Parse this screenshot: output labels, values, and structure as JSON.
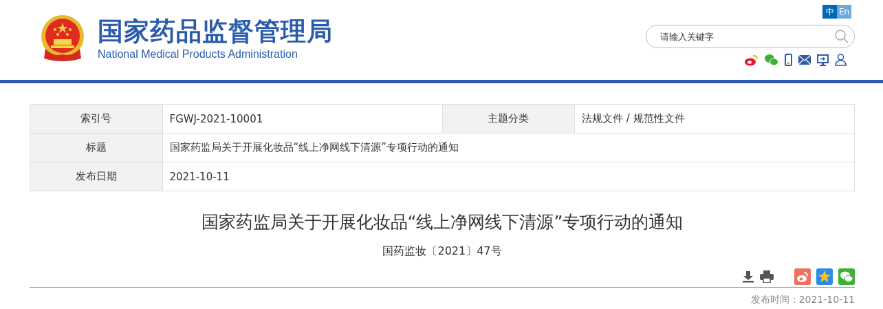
{
  "header": {
    "title_cn": "国家药品监督管理局",
    "title_en": "National Medical Products Administration",
    "languages": [
      {
        "label": "中",
        "selected": true
      },
      {
        "label": "En",
        "selected": false
      }
    ],
    "search": {
      "placeholder": "请输入关键字"
    }
  },
  "info_table": {
    "rows": [
      [
        {
          "kind": "label",
          "text": "索引号"
        },
        {
          "kind": "value",
          "text": "FGWJ-2021-10001"
        },
        {
          "kind": "label",
          "text": "主题分类"
        },
        {
          "kind": "value",
          "text": "法规文件 / 规范性文件"
        }
      ],
      [
        {
          "kind": "label",
          "text": "标题"
        },
        {
          "kind": "value",
          "colspan": 3,
          "text": "国家药监局关于开展化妆品“线上净网线下清源”专项行动的通知"
        }
      ],
      [
        {
          "kind": "label",
          "text": "发布日期"
        },
        {
          "kind": "value",
          "colspan": 3,
          "text": "2021-10-11"
        }
      ]
    ]
  },
  "article": {
    "title": "国家药监局关于开展化妆品“线上净网线下清源”专项行动的通知",
    "doc_number": "国药监妆〔2021〕47号",
    "publish_time": "发布时间：2021-10-11"
  }
}
